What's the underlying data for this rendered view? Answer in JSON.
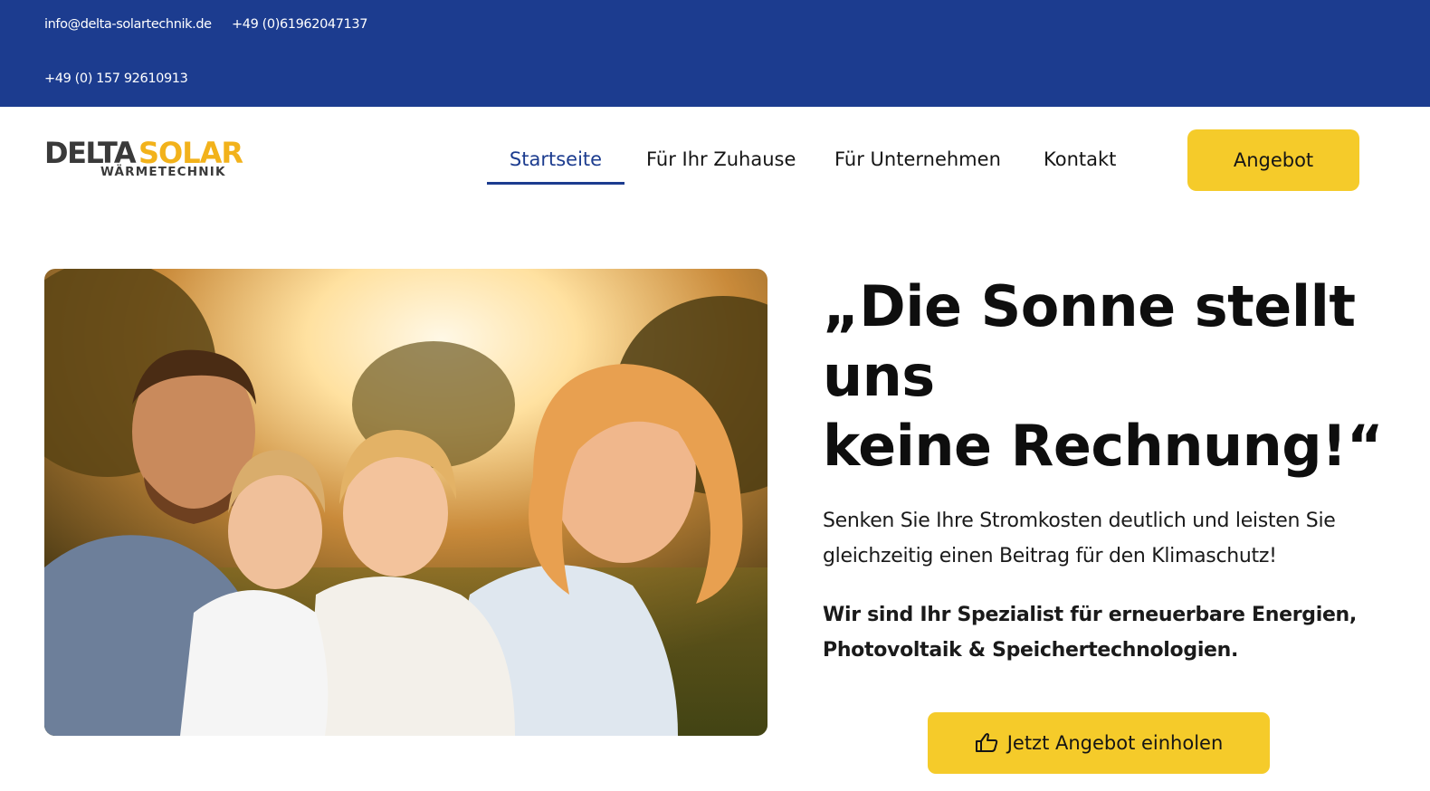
{
  "topbar": {
    "email": "info@delta-solartechnik.de",
    "phone1": "+49 (0)61962047137",
    "phone2": "+49 (0) 157 92610913",
    "background": "#1c3c8f"
  },
  "logo": {
    "word1": "DELTA",
    "word2": "SOLAR",
    "tagline": "WÄRMETECHNIK",
    "accent": "#f2b21b"
  },
  "nav": {
    "items": [
      {
        "label": "Startseite",
        "active": true
      },
      {
        "label": "Für Ihr Zuhause"
      },
      {
        "label": "Für Unternehmen"
      },
      {
        "label": "Kontakt"
      }
    ],
    "offer_label": "Angebot"
  },
  "hero": {
    "title_lines": [
      "„Die Sonne stellt",
      "uns",
      "keine Rechnung!“"
    ],
    "text": "Senken Sie Ihre Stromkosten deutlich und leisten Sie gleichzeitig einen Beitrag für den Klimaschutz!",
    "text_bold": "Wir sind Ihr Spezialist für erneuerbare Energien, Photovoltaik & Speichertechnologien.",
    "cta_label": "Jetzt Angebot einholen",
    "cta_icon": "thumbs-up-icon",
    "image": "family-photo",
    "accent": "#f5cb2a"
  }
}
